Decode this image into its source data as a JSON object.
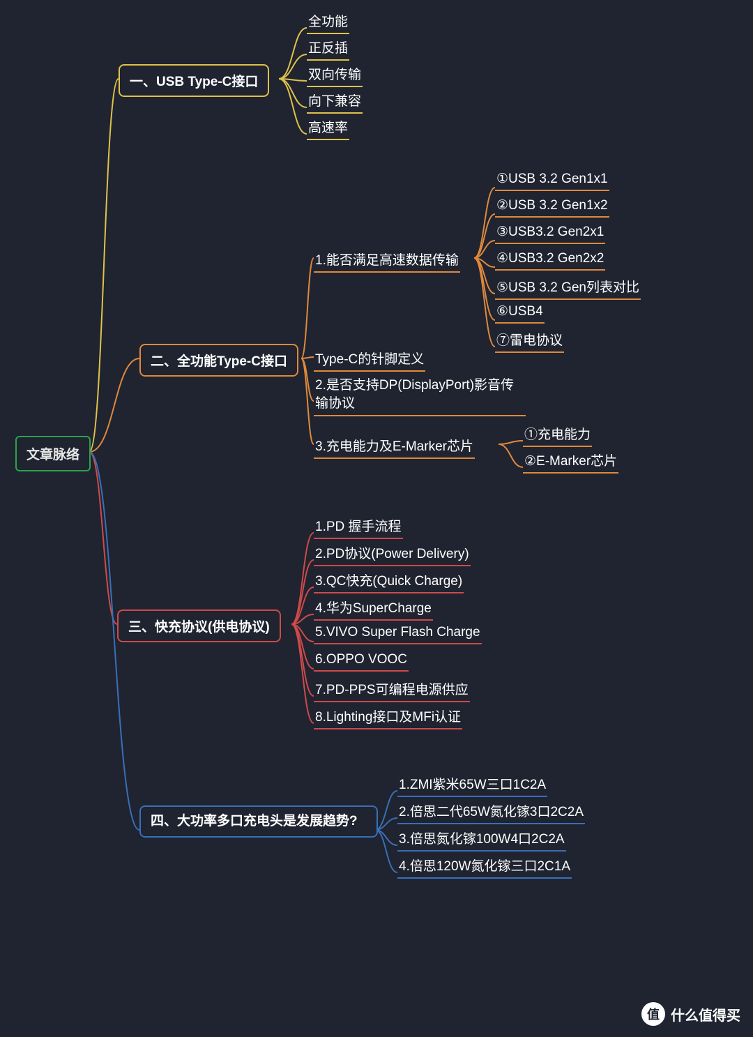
{
  "root": {
    "label": "文章脉络"
  },
  "branches": [
    {
      "id": "b1",
      "color": "yellow",
      "label": "一、USB Type-C接口",
      "children": [
        {
          "label": "全功能"
        },
        {
          "label": "正反插"
        },
        {
          "label": "双向传输"
        },
        {
          "label": "向下兼容"
        },
        {
          "label": "高速率"
        }
      ]
    },
    {
      "id": "b2",
      "color": "orange",
      "label": "二、全功能Type-C接口",
      "children": [
        {
          "label": "1.能否满足高速数据传输",
          "children": [
            {
              "label": "①USB 3.2 Gen1x1"
            },
            {
              "label": "②USB 3.2 Gen1x2"
            },
            {
              "label": "③USB3.2 Gen2x1"
            },
            {
              "label": "④USB3.2 Gen2x2"
            },
            {
              "label": "⑤USB 3.2 Gen列表对比"
            },
            {
              "label": "⑥USB4"
            },
            {
              "label": "⑦雷电协议"
            }
          ]
        },
        {
          "label": "Type-C的针脚定义"
        },
        {
          "label": "2.是否支持DP(DisplayPort)影音传输协议",
          "wrap": true
        },
        {
          "label": "3.充电能力及E-Marker芯片",
          "children": [
            {
              "label": "①充电能力"
            },
            {
              "label": "②E-Marker芯片"
            }
          ]
        }
      ]
    },
    {
      "id": "b3",
      "color": "red",
      "label": "三、快充协议(供电协议)",
      "children": [
        {
          "label": "1.PD 握手流程"
        },
        {
          "label": "2.PD协议(Power Delivery)"
        },
        {
          "label": "3.QC快充(Quick Charge)"
        },
        {
          "label": "4.华为SuperCharge"
        },
        {
          "label": "5.VIVO Super Flash Charge"
        },
        {
          "label": "6.OPPO VOOC"
        },
        {
          "label": "7.PD-PPS可编程电源供应"
        },
        {
          "label": "8.Lighting接口及MFi认证"
        }
      ]
    },
    {
      "id": "b4",
      "color": "blue",
      "label": "四、大功率多口充电头是发展趋势?",
      "wrap": true,
      "children": [
        {
          "label": "1.ZMI紫米65W三口1C2A"
        },
        {
          "label": "2.倍思二代65W氮化镓3口2C2A"
        },
        {
          "label": "3.倍思氮化镓100W4口2C2A"
        },
        {
          "label": "4.倍思120W氮化镓三口2C1A"
        }
      ]
    }
  ],
  "watermark": {
    "badge": "值",
    "text": "什么值得买"
  },
  "colors": {
    "yellow": "#e0c24a",
    "orange": "#e0893c",
    "red": "#cf4a4a",
    "blue": "#3a6fb7",
    "green": "#2aa34a"
  }
}
